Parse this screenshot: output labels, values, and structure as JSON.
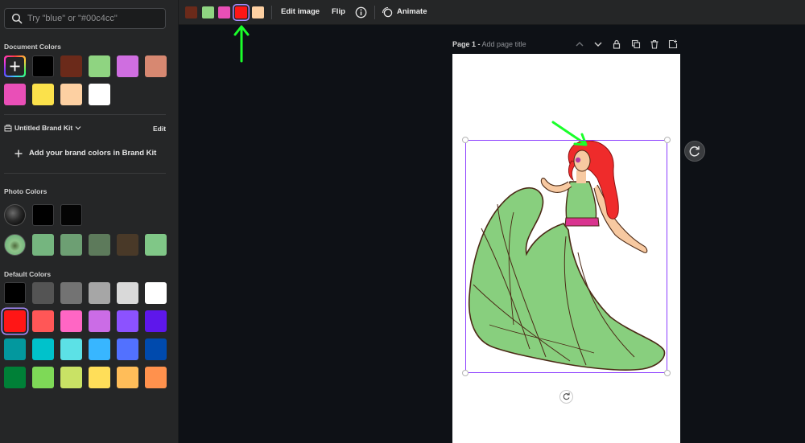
{
  "sidebar": {
    "search_placeholder": "Try \"blue\" or \"#00c4cc\"",
    "document_colors": {
      "label": "Document Colors",
      "swatches": [
        "#000000",
        "#6b2a1a",
        "#8fd481",
        "#cf6ee0",
        "#d78871",
        "#e94fb7",
        "#fbe14b",
        "#fdd0a2",
        "#ffffff"
      ]
    },
    "brand_kit": {
      "label": "Untitled Brand Kit",
      "edit_label": "Edit",
      "add_label": "Add your brand colors in Brand Kit"
    },
    "photo_colors": {
      "label": "Photo Colors",
      "row1": [
        "#000000",
        "#040404"
      ],
      "row2": [
        "#75b57f",
        "#6d9f73",
        "#5d7a5b",
        "#493928",
        "#80c787"
      ]
    },
    "default_colors": {
      "label": "Default Colors",
      "rows": [
        [
          "#000000",
          "#545454",
          "#737373",
          "#a6a6a6",
          "#d9d9d9",
          "#ffffff"
        ],
        [
          "#ff1616",
          "#ff5757",
          "#ff66c4",
          "#cb6ce6",
          "#8c52ff",
          "#5e17eb"
        ],
        [
          "#03989e",
          "#00c2cb",
          "#5ce1e6",
          "#38b6ff",
          "#5271ff",
          "#004aad"
        ],
        [
          "#008037",
          "#7ed957",
          "#c9e265",
          "#ffde59",
          "#ffbd59",
          "#ff914d"
        ]
      ],
      "selected": "#ff1616"
    }
  },
  "toolbar": {
    "swatches": [
      "#6b2a1a",
      "#8fd481",
      "#e94fb7",
      "#ff1616",
      "#fdd0a2"
    ],
    "edit_image_label": "Edit image",
    "flip_label": "Flip",
    "animate_label": "Animate"
  },
  "canvas": {
    "page_label": "Page 1 -",
    "page_title_placeholder": "Add page title"
  },
  "colors": {
    "accent_selection": "#8b3dff",
    "arrow_green": "#1aff2a"
  }
}
